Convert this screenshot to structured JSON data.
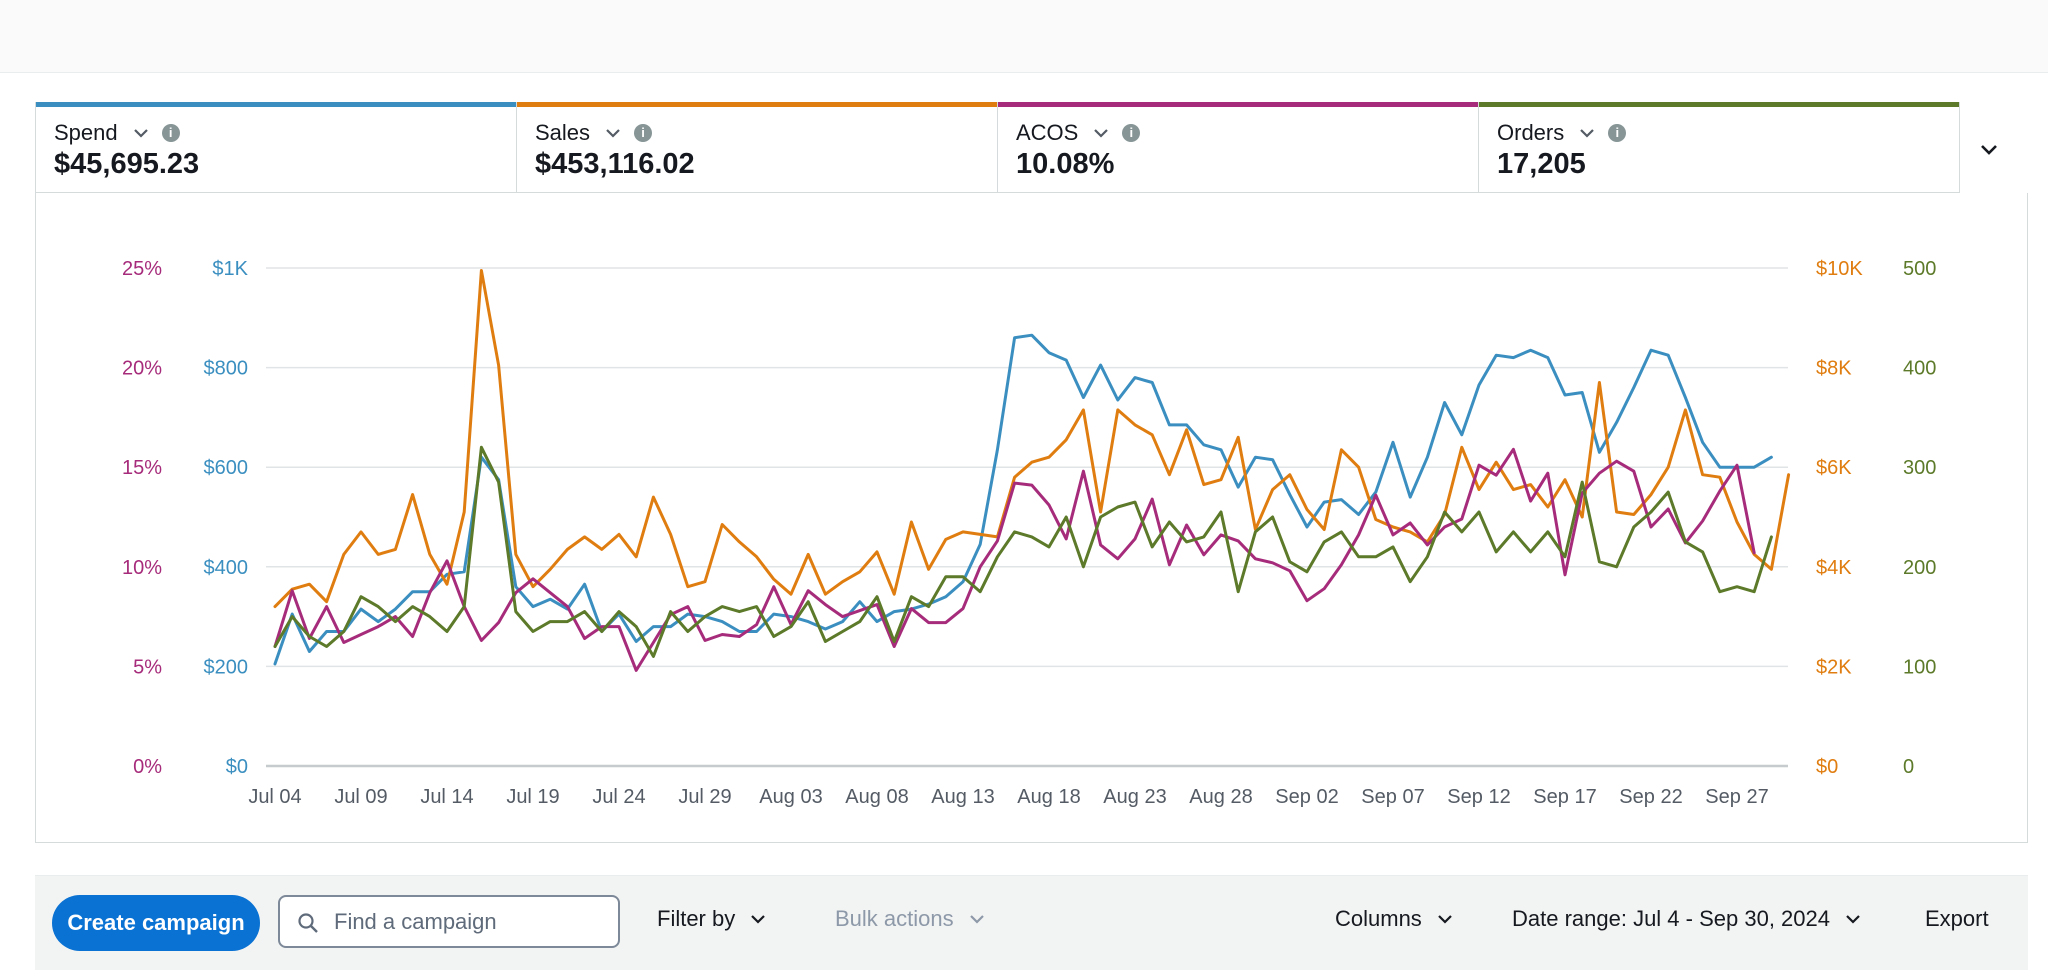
{
  "metrics": [
    {
      "label": "Spend",
      "value": "$45,695.23",
      "color": "#3b8fc0"
    },
    {
      "label": "Sales",
      "value": "$453,116.02",
      "color": "#e07d10"
    },
    {
      "label": "ACOS",
      "value": "10.08%",
      "color": "#a62c7b"
    },
    {
      "label": "Orders",
      "value": "17,205",
      "color": "#5c7a29"
    }
  ],
  "toolbar": {
    "create_label": "Create campaign",
    "search_placeholder": "Find a campaign",
    "filter_label": "Filter by",
    "bulk_label": "Bulk actions",
    "columns_label": "Columns",
    "date_range_label": "Date range: Jul 4 - Sep 30, 2024",
    "export_label": "Export"
  },
  "icons": {
    "caret": "chevron-down-icon",
    "info": "info-icon",
    "search": "search-icon",
    "collapse": "chevron-down-icon"
  },
  "chart_data": {
    "type": "line",
    "x": [
      "Jul 04",
      "Jul 05",
      "Jul 06",
      "Jul 07",
      "Jul 08",
      "Jul 09",
      "Jul 10",
      "Jul 11",
      "Jul 12",
      "Jul 13",
      "Jul 14",
      "Jul 15",
      "Jul 16",
      "Jul 17",
      "Jul 18",
      "Jul 19",
      "Jul 20",
      "Jul 21",
      "Jul 22",
      "Jul 23",
      "Jul 24",
      "Jul 25",
      "Jul 26",
      "Jul 27",
      "Jul 28",
      "Jul 29",
      "Jul 30",
      "Jul 31",
      "Aug 01",
      "Aug 02",
      "Aug 03",
      "Aug 04",
      "Aug 05",
      "Aug 06",
      "Aug 07",
      "Aug 08",
      "Aug 09",
      "Aug 10",
      "Aug 11",
      "Aug 12",
      "Aug 13",
      "Aug 14",
      "Aug 15",
      "Aug 16",
      "Aug 17",
      "Aug 18",
      "Aug 19",
      "Aug 20",
      "Aug 21",
      "Aug 22",
      "Aug 23",
      "Aug 24",
      "Aug 25",
      "Aug 26",
      "Aug 27",
      "Aug 28",
      "Aug 29",
      "Aug 30",
      "Aug 31",
      "Sep 01",
      "Sep 02",
      "Sep 03",
      "Sep 04",
      "Sep 05",
      "Sep 06",
      "Sep 07",
      "Sep 08",
      "Sep 09",
      "Sep 10",
      "Sep 11",
      "Sep 12",
      "Sep 13",
      "Sep 14",
      "Sep 15",
      "Sep 16",
      "Sep 17",
      "Sep 18",
      "Sep 19",
      "Sep 20",
      "Sep 21",
      "Sep 22",
      "Sep 23",
      "Sep 24",
      "Sep 25",
      "Sep 26",
      "Sep 27",
      "Sep 28",
      "Sep 29",
      "Sep 30"
    ],
    "x_tick_labels": [
      "Jul 04",
      "Jul 09",
      "Jul 14",
      "Jul 19",
      "Jul 24",
      "Jul 29",
      "Aug 03",
      "Aug 08",
      "Aug 13",
      "Aug 18",
      "Aug 23",
      "Aug 28",
      "Sep 02",
      "Sep 07",
      "Sep 12",
      "Sep 17",
      "Sep 22",
      "Sep 27"
    ],
    "axes": [
      {
        "id": "acos",
        "side": "left-outer",
        "ticks": [
          "0%",
          "5%",
          "10%",
          "15%",
          "20%",
          "25%"
        ],
        "range": [
          0,
          25
        ],
        "color": "#a62c7b"
      },
      {
        "id": "spend",
        "side": "left-inner",
        "ticks": [
          "$0",
          "$200",
          "$400",
          "$600",
          "$800",
          "$1K"
        ],
        "range": [
          0,
          1000
        ],
        "color": "#3b8fc0"
      },
      {
        "id": "sales",
        "side": "right-inner",
        "ticks": [
          "$0",
          "$2K",
          "$4K",
          "$6K",
          "$8K",
          "$10K"
        ],
        "range": [
          0,
          10000
        ],
        "color": "#e07d10"
      },
      {
        "id": "orders",
        "side": "right-outer",
        "ticks": [
          "0",
          "100",
          "200",
          "300",
          "400",
          "500"
        ],
        "range": [
          0,
          500
        ],
        "color": "#5c7a29"
      }
    ],
    "grid": true,
    "series": [
      {
        "name": "Spend",
        "axis": "spend",
        "color": "#3b8fc0",
        "values": [
          205,
          305,
          230,
          270,
          270,
          315,
          290,
          315,
          350,
          350,
          385,
          390,
          620,
          575,
          360,
          320,
          335,
          315,
          365,
          270,
          305,
          250,
          280,
          280,
          305,
          300,
          290,
          270,
          270,
          305,
          300,
          290,
          275,
          290,
          330,
          290,
          310,
          315,
          325,
          340,
          370,
          445,
          635,
          860,
          865,
          830,
          815,
          740,
          805,
          735,
          780,
          770,
          685,
          685,
          645,
          635,
          560,
          620,
          615,
          545,
          480,
          530,
          535,
          505,
          550,
          650,
          540,
          620,
          730,
          665,
          765,
          825,
          820,
          835,
          820,
          745,
          750,
          630,
          690,
          760,
          835,
          825,
          740,
          650,
          600,
          600,
          600,
          620
        ]
      },
      {
        "name": "Sales",
        "axis": "sales",
        "color": "#e07d10",
        "values": [
          3200,
          3550,
          3650,
          3300,
          4250,
          4700,
          4250,
          4350,
          5450,
          4250,
          3650,
          5100,
          9950,
          8050,
          4250,
          3600,
          3950,
          4350,
          4600,
          4350,
          4650,
          4200,
          5400,
          4650,
          3600,
          3700,
          4850,
          4500,
          4200,
          3750,
          3450,
          4250,
          3450,
          3700,
          3900,
          4300,
          3450,
          4900,
          3950,
          4550,
          4700,
          4650,
          4600,
          5800,
          6100,
          6200,
          6550,
          7150,
          5100,
          7150,
          6850,
          6650,
          5850,
          6750,
          5650,
          5750,
          6600,
          4750,
          5550,
          5850,
          5150,
          4750,
          6350,
          6000,
          4950,
          4800,
          4700,
          4500,
          5050,
          6400,
          5550,
          6100,
          5550,
          5650,
          5200,
          5750,
          5000,
          7700,
          5100,
          5050,
          5450,
          6000,
          7150,
          5850,
          5800,
          4900,
          4250,
          3950,
          5850
        ]
      },
      {
        "name": "ACOS",
        "axis": "acos",
        "color": "#a62c7b",
        "values": [
          6.0,
          8.8,
          6.4,
          8.0,
          6.2,
          6.6,
          7.0,
          7.5,
          6.5,
          8.7,
          10.3,
          8.0,
          6.3,
          7.2,
          8.7,
          9.4,
          8.7,
          8.0,
          6.4,
          7.0,
          7.0,
          4.8,
          6.2,
          7.6,
          8.0,
          6.3,
          6.6,
          6.5,
          7.1,
          9.0,
          7.1,
          8.8,
          8.1,
          7.5,
          7.8,
          8.1,
          6.0,
          7.9,
          7.2,
          7.2,
          7.9,
          10.0,
          11.3,
          14.2,
          14.1,
          13.1,
          11.4,
          14.8,
          11.1,
          10.4,
          11.4,
          13.4,
          10.1,
          12.1,
          10.6,
          11.6,
          11.3,
          10.4,
          10.2,
          9.8,
          8.3,
          8.9,
          10.1,
          11.6,
          13.6,
          11.6,
          12.2,
          11.1,
          12.0,
          12.4,
          15.1,
          14.6,
          15.9,
          13.3,
          14.7,
          9.6,
          13.7,
          14.7,
          15.3,
          14.8,
          12.0,
          12.9,
          11.2,
          12.3,
          13.8,
          15.1,
          10.7
        ]
      },
      {
        "name": "Orders",
        "axis": "orders",
        "color": "#5c7a29",
        "values": [
          120,
          150,
          130,
          120,
          135,
          170,
          160,
          145,
          160,
          150,
          135,
          160,
          320,
          285,
          155,
          135,
          145,
          145,
          155,
          135,
          155,
          140,
          110,
          155,
          135,
          150,
          160,
          155,
          160,
          130,
          140,
          165,
          125,
          135,
          145,
          170,
          125,
          170,
          160,
          190,
          190,
          175,
          210,
          235,
          230,
          220,
          250,
          200,
          250,
          260,
          265,
          220,
          245,
          225,
          230,
          255,
          175,
          235,
          250,
          205,
          195,
          225,
          235,
          210,
          210,
          220,
          185,
          210,
          255,
          235,
          255,
          215,
          235,
          215,
          235,
          210,
          285,
          205,
          200,
          240,
          255,
          275,
          225,
          215,
          175,
          180,
          175,
          230
        ]
      }
    ]
  }
}
